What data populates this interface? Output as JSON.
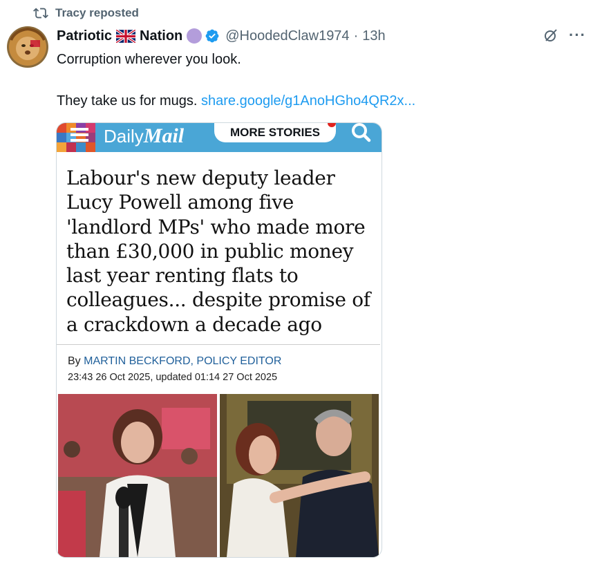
{
  "repost": {
    "label": "Tracy reposted",
    "icon": "repost-icon"
  },
  "author": {
    "name_part1": "Patriotic",
    "name_part2": "Nation",
    "handle": "@HoodedClaw1974",
    "separator": "·",
    "time": "13h",
    "flag_icon": "union-jack-flag-icon",
    "verified_icon": "verified-badge-icon",
    "accent": "#1d9bf0"
  },
  "tweet": {
    "line1": "Corruption wherever you look.",
    "line2": "They take us for mugs.",
    "link": "share.google/g1AnoHGho4QR2x..."
  },
  "card": {
    "brand_daily": "Daily",
    "brand_mail": "Mail",
    "more_stories": "MORE STORIES",
    "headline": "Labour's new deputy leader Lucy Powell among five 'landlord MPs' who made more than £30,000 in public money last year renting flats to colleagues... despite promise of a crackdown a decade ago",
    "byline_prefix": "By",
    "byline_author": "MARTIN BECKFORD, POLICY EDITOR",
    "dateline": "23:43 26 Oct 2025, updated 01:14 27 Oct 2025",
    "bar_color": "#4aa6d6"
  }
}
